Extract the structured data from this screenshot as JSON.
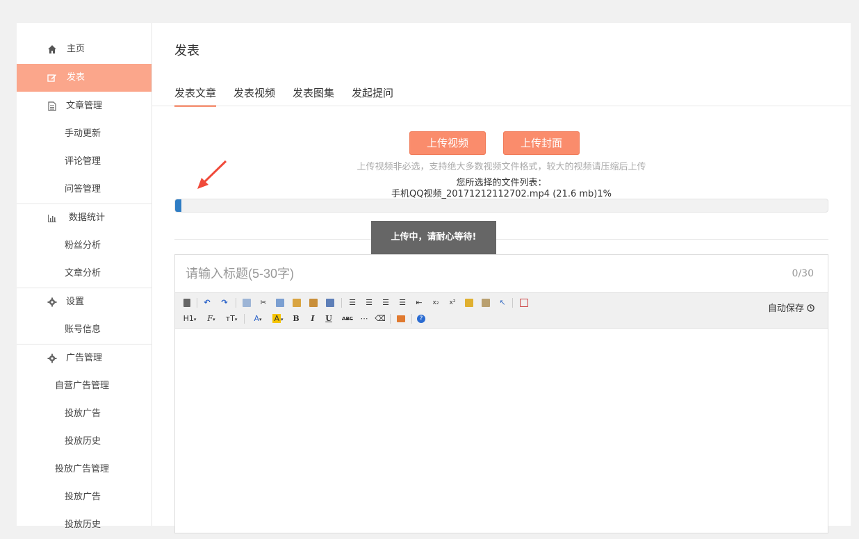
{
  "sidebar": {
    "items": [
      {
        "label": "主页",
        "icon": "home-icon"
      },
      {
        "label": "发表",
        "icon": "edit-icon",
        "active": true
      },
      {
        "label": "文章管理",
        "icon": "document-icon"
      },
      {
        "label": "手动更新"
      },
      {
        "label": "评论管理"
      },
      {
        "label": "问答管理"
      },
      {
        "label": "数据统计",
        "icon": "bar-chart-icon"
      },
      {
        "label": "粉丝分析"
      },
      {
        "label": "文章分析"
      },
      {
        "label": "设置",
        "icon": "gear-icon"
      },
      {
        "label": "账号信息"
      },
      {
        "label": "广告管理",
        "icon": "gear-icon"
      },
      {
        "label": "自营广告管理"
      },
      {
        "label": "投放广告"
      },
      {
        "label": "投放历史"
      },
      {
        "label": "投放广告管理"
      },
      {
        "label": "投放广告"
      },
      {
        "label": "投放历史"
      }
    ]
  },
  "main": {
    "title": "发表",
    "tabs": [
      {
        "label": "发表文章",
        "active": true
      },
      {
        "label": "发表视频"
      },
      {
        "label": "发表图集"
      },
      {
        "label": "发起提问"
      }
    ],
    "upload": {
      "video_button": "上传视频",
      "cover_button": "上传封面",
      "hint": "上传视频非必选，支持绝大多数视频文件格式，较大的视频请压缩后上传",
      "file_list_label": "您所选择的文件列表：",
      "file_line": "手机QQ视频_20171212112702.mp4 (21.6 mb)1%",
      "progress_percent": 1,
      "toast": "上传中，请耐心等待!"
    },
    "editor": {
      "title_placeholder": "请输入标题(5-30字)",
      "counter": "0/30",
      "autosave_label": "自动保存",
      "toolbar_row2_text": {
        "heading": "H1",
        "font": "F",
        "size": "тT",
        "font_color": "A",
        "highlight": "A",
        "bold": "B",
        "italic": "I",
        "underline": "U",
        "strike": "ABC"
      }
    }
  },
  "colors": {
    "accent": "#fa8c6c",
    "active_nav": "#fba68b",
    "progress": "#2f7dc4"
  }
}
